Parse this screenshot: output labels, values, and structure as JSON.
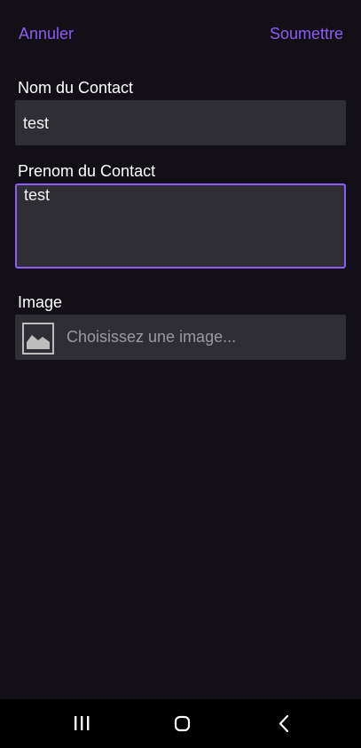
{
  "header": {
    "cancel_label": "Annuler",
    "submit_label": "Soumettre",
    "accent_color": "#8b5cf6"
  },
  "form": {
    "last_name": {
      "label": "Nom du Contact",
      "value": "test"
    },
    "first_name": {
      "label": "Prenom du Contact",
      "value": "test"
    },
    "image": {
      "label": "Image",
      "placeholder": "Choisissez une image...",
      "icon": "image-icon"
    }
  },
  "nav_bar": {
    "recents_icon": "recents-icon",
    "home_icon": "home-icon",
    "back_icon": "back-icon"
  }
}
